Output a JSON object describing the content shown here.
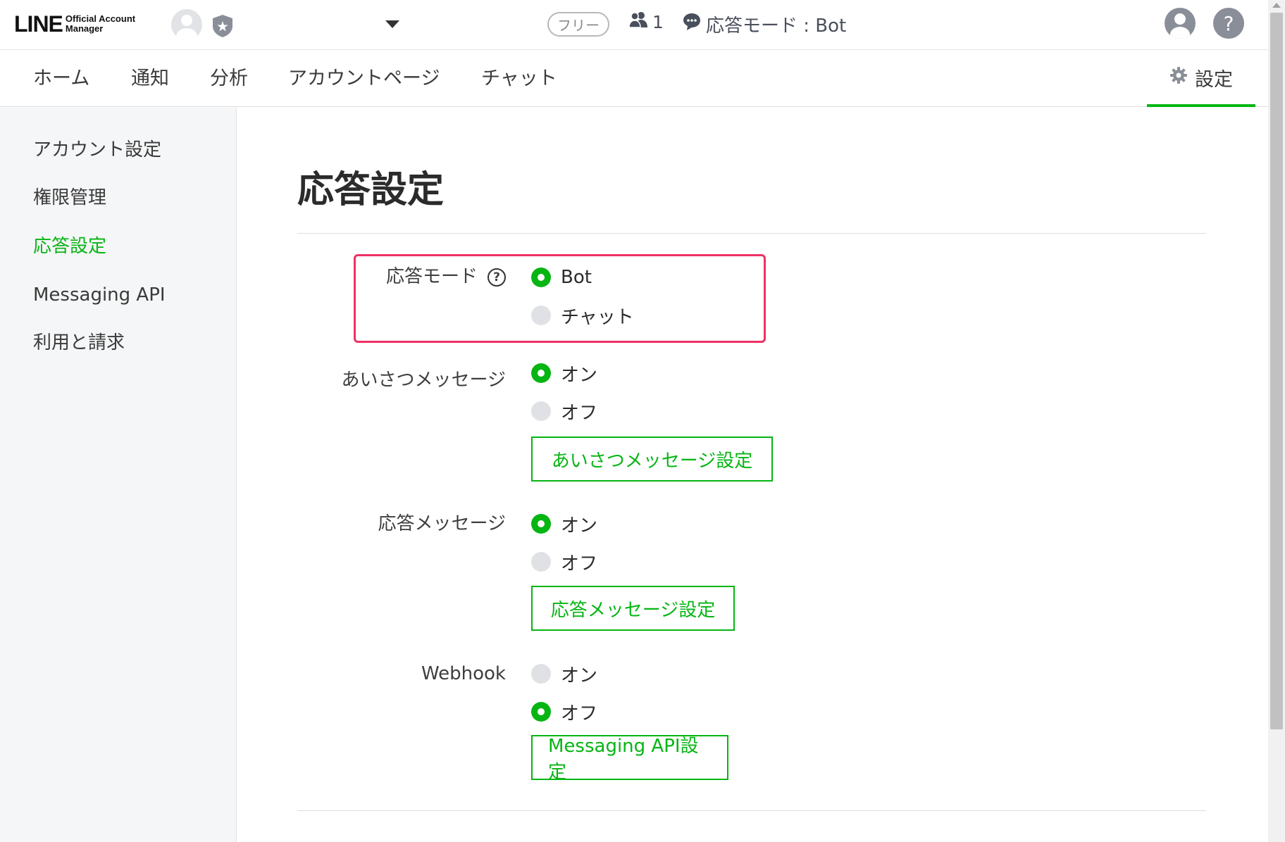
{
  "header": {
    "logo_main": "LINE",
    "logo_sub_1": "Official Account",
    "logo_sub_2": "Manager",
    "plan_badge": "フリー",
    "friend_count": "1",
    "response_mode_text": "応答モード : Bot",
    "icons": [
      "account-avatar-icon",
      "shield-star-icon",
      "dropdown-caret-icon",
      "friends-icon",
      "chat-bubble-icon",
      "user-icon",
      "help-icon"
    ]
  },
  "nav": {
    "items": [
      {
        "label": "ホーム"
      },
      {
        "label": "通知"
      },
      {
        "label": "分析"
      },
      {
        "label": "アカウントページ"
      },
      {
        "label": "チャット"
      }
    ],
    "settings_label": "設定"
  },
  "sidebar": {
    "items": [
      {
        "label": "アカウント設定",
        "active": false
      },
      {
        "label": "権限管理",
        "active": false
      },
      {
        "label": "応答設定",
        "active": true
      },
      {
        "label": "Messaging API",
        "active": false
      },
      {
        "label": "利用と請求",
        "active": false
      }
    ]
  },
  "main": {
    "title": "応答設定",
    "response_mode": {
      "label": "応答モード",
      "help": "?",
      "options": [
        {
          "label": "Bot",
          "selected": true
        },
        {
          "label": "チャット",
          "selected": false
        }
      ]
    },
    "greeting": {
      "label": "あいさつメッセージ",
      "options": [
        {
          "label": "オン",
          "selected": true
        },
        {
          "label": "オフ",
          "selected": false
        }
      ],
      "button_label": "あいさつメッセージ設定"
    },
    "auto_response": {
      "label": "応答メッセージ",
      "options": [
        {
          "label": "オン",
          "selected": true
        },
        {
          "label": "オフ",
          "selected": false
        }
      ],
      "button_label": "応答メッセージ設定"
    },
    "webhook": {
      "label": "Webhook",
      "options": [
        {
          "label": "オン",
          "selected": false
        },
        {
          "label": "オフ",
          "selected": true
        }
      ],
      "button_label": "Messaging API設定"
    }
  },
  "colors": {
    "accent": "#06b513",
    "highlight": "#ee3166",
    "sidebar_bg": "#f5f6f7",
    "radio_off": "#dfe1e5"
  }
}
